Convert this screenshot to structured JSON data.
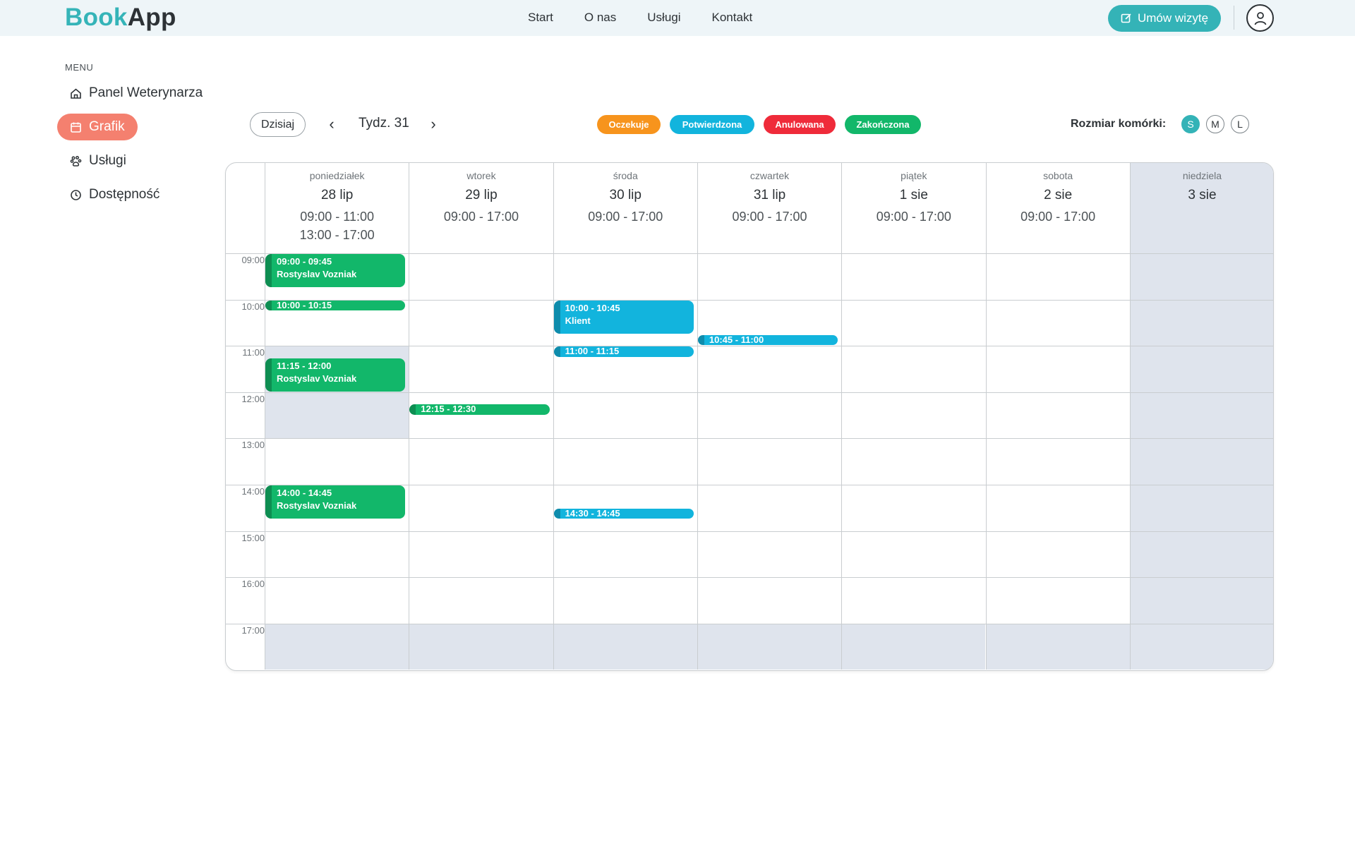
{
  "header": {
    "logo_part1": "Book",
    "logo_part2": "App",
    "nav": [
      "Start",
      "O nas",
      "Usługi",
      "Kontakt"
    ],
    "cta_label": "Umów wizytę",
    "brand_color": "#34b3b7"
  },
  "sidebar": {
    "title": "MENU",
    "items": [
      {
        "label": "Panel Weterynarza",
        "icon": "home-icon",
        "active": false
      },
      {
        "label": "Grafik",
        "icon": "calendar-icon",
        "active": true
      },
      {
        "label": "Usługi",
        "icon": "paw-icon",
        "active": false
      },
      {
        "label": "Dostępność",
        "icon": "clock-icon",
        "active": false
      }
    ],
    "active_color": "#f4806f"
  },
  "toolbar": {
    "today_label": "Dzisiaj",
    "week_label": "Tydz. 31",
    "legend": [
      {
        "label": "Oczekuje",
        "color": "#f7941d"
      },
      {
        "label": "Potwierdzona",
        "color": "#12b4dd"
      },
      {
        "label": "Anulowana",
        "color": "#ef2b3a"
      },
      {
        "label": "Zakończona",
        "color": "#12b76a"
      }
    ],
    "size_label": "Rozmiar komórki:",
    "sizes": [
      "S",
      "M",
      "L"
    ],
    "active_size": "S"
  },
  "calendar": {
    "hours": [
      "09:00",
      "10:00",
      "11:00",
      "12:00",
      "13:00",
      "14:00",
      "15:00",
      "16:00",
      "17:00"
    ],
    "days": [
      {
        "name": "poniedziałek",
        "date": "28 lip",
        "hours": [
          "09:00 - 11:00",
          "13:00 - 17:00"
        ]
      },
      {
        "name": "wtorek",
        "date": "29 lip",
        "hours": [
          "09:00 - 17:00"
        ]
      },
      {
        "name": "środa",
        "date": "30 lip",
        "hours": [
          "09:00 - 17:00"
        ]
      },
      {
        "name": "czwartek",
        "date": "31 lip",
        "hours": [
          "09:00 - 17:00"
        ]
      },
      {
        "name": "piątek",
        "date": "1 sie",
        "hours": [
          "09:00 - 17:00"
        ]
      },
      {
        "name": "sobota",
        "date": "2 sie",
        "hours": [
          "09:00 - 17:00"
        ]
      },
      {
        "name": "niedziela",
        "date": "3 sie",
        "hours": []
      }
    ],
    "events": [
      {
        "day": 0,
        "time": "09:00 - 09:45",
        "client": "Rostyslav Vozniak",
        "status": "green"
      },
      {
        "day": 0,
        "time": "10:00 - 10:15",
        "client": "",
        "status": "green"
      },
      {
        "day": 0,
        "time": "11:15 - 12:00",
        "client": "Rostyslav Vozniak",
        "status": "green"
      },
      {
        "day": 0,
        "time": "14:00 - 14:45",
        "client": "Rostyslav Vozniak",
        "status": "green"
      },
      {
        "day": 1,
        "time": "12:15 - 12:30",
        "client": "",
        "status": "green"
      },
      {
        "day": 2,
        "time": "10:00 - 10:45",
        "client": "Klient",
        "status": "blue"
      },
      {
        "day": 2,
        "time": "11:00 - 11:15",
        "client": "",
        "status": "blue"
      },
      {
        "day": 2,
        "time": "14:30 - 14:45",
        "client": "",
        "status": "blue"
      },
      {
        "day": 3,
        "time": "10:45 - 11:00",
        "client": "",
        "status": "blue"
      }
    ]
  }
}
